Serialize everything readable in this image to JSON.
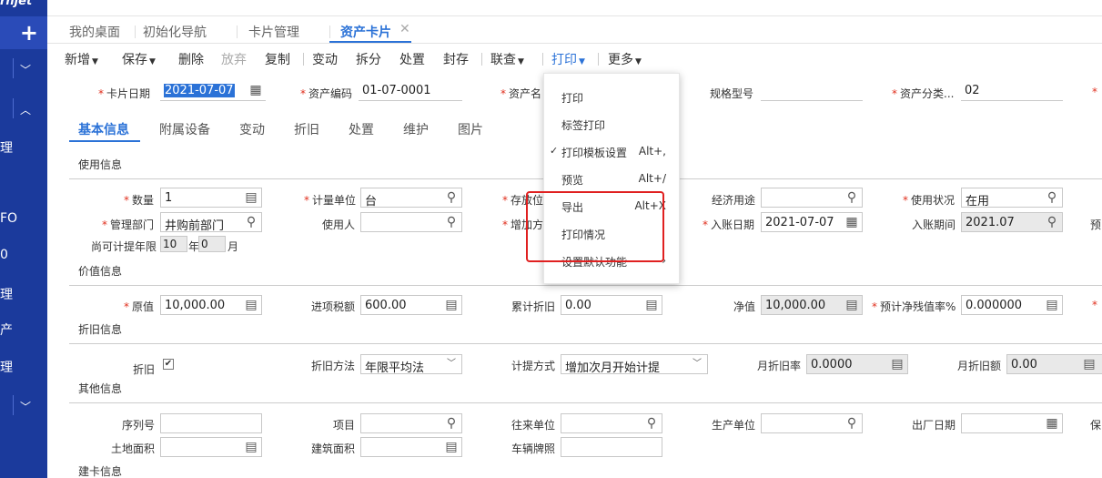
{
  "sidebar": {
    "logo": "rnjet",
    "labels": [
      "理",
      "FO",
      "0",
      "理",
      "产",
      "理"
    ]
  },
  "topbar": {
    "text": ""
  },
  "tabs": [
    {
      "label": "我的桌面"
    },
    {
      "label": "初始化导航"
    },
    {
      "label": "卡片管理"
    },
    {
      "label": "资产卡片"
    }
  ],
  "toolbar": {
    "new": "新增",
    "save": "保存",
    "delete": "删除",
    "discard": "放弃",
    "copy": "复制",
    "change": "变动",
    "split": "拆分",
    "dispose": "处置",
    "seal": "封存",
    "linked": "联查",
    "print": "打印",
    "more": "更多"
  },
  "header": {
    "card_date_label": "卡片日期",
    "card_date": "2021-07-07",
    "asset_code_label": "资产编码",
    "asset_code": "01-07-0001",
    "asset_name_label": "资产名",
    "spec_label": "规格型号",
    "category_label": "资产分类...",
    "category": "02"
  },
  "subtabs": [
    "基本信息",
    "附属设备",
    "变动",
    "折旧",
    "处置",
    "维护",
    "图片"
  ],
  "sections": {
    "usage": "使用信息",
    "value": "价值信息",
    "depreciation": "折旧信息",
    "other": "其他信息",
    "build": "建卡信息"
  },
  "usage": {
    "qty_label": "数量",
    "qty": "1",
    "unit_label": "计量单位",
    "unit": "台",
    "storage_label": "存放位",
    "purpose_label": "经济用途",
    "status_label": "使用状况",
    "status": "在用",
    "dept_label": "管理部门",
    "dept": "井购前部门",
    "user_label": "使用人",
    "add_label": "增加方",
    "entry_date_label": "入账日期",
    "entry_date": "2021-07-07",
    "entry_period_label": "入账期间",
    "entry_period": "2021.07",
    "pre_label": "预",
    "remain_label": "尚可计提年限",
    "remain_years": "10",
    "year_unit": "年",
    "remain_months": "0",
    "month_unit": "月"
  },
  "value": {
    "orig_label": "原值",
    "orig": "10,000.00",
    "tax_label": "进项税额",
    "tax": "600.00",
    "accum_label": "累计折旧",
    "accum": "0.00",
    "net_label": "净值",
    "net": "10,000.00",
    "residual_label": "预计净残值率%",
    "residual": "0.000000"
  },
  "depr": {
    "depr_label": "折旧",
    "depr_check": "✔",
    "method_label": "折旧方法",
    "method": "年限平均法",
    "mode_label": "计提方式",
    "mode": "增加次月开始计提",
    "rate_label": "月折旧率",
    "rate": "0.0000",
    "amount_label": "月折旧额",
    "amount": "0.00"
  },
  "other": {
    "serial_label": "序列号",
    "project_label": "项目",
    "partner_label": "往来单位",
    "maker_label": "生产单位",
    "factory_date_label": "出厂日期",
    "guarantee_label": "保",
    "land_label": "土地面积",
    "build_label": "建筑面积",
    "plate_label": "车辆牌照"
  },
  "print_menu": [
    {
      "label": "打印",
      "shortcut": ""
    },
    {
      "label": "标签打印",
      "shortcut": ""
    },
    {
      "label": "打印模板设置",
      "shortcut": "Alt+,",
      "checked": true
    },
    {
      "label": "预览",
      "shortcut": "Alt+/"
    },
    {
      "label": "导出",
      "shortcut": "Alt+X"
    },
    {
      "label": "打印情况",
      "shortcut": ""
    },
    {
      "label": "设置默认功能",
      "shortcut": "›"
    }
  ],
  "colors": {
    "sidebar": "#1b3a9c",
    "accent": "#2b72d7",
    "highlight": "#e02020"
  }
}
